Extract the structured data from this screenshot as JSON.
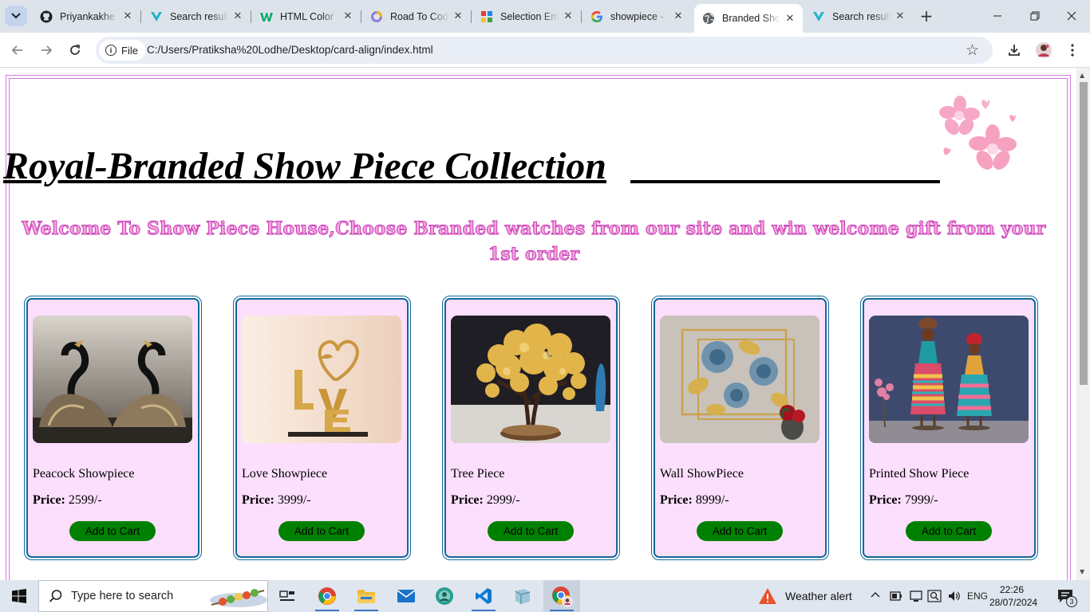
{
  "browser": {
    "tabs": [
      {
        "label": "Priyankakhe",
        "icon": "github-icon",
        "active": false
      },
      {
        "label": "Search result",
        "icon": "v-logo-icon",
        "active": false
      },
      {
        "label": "HTML Color",
        "icon": "w-logo-icon",
        "active": false
      },
      {
        "label": "Road To Cod",
        "icon": "ring-logo-icon",
        "active": false
      },
      {
        "label": "Selection Em",
        "icon": "grid-logo-icon",
        "active": false
      },
      {
        "label": "showpiece -",
        "icon": "google-icon",
        "active": false
      },
      {
        "label": "Branded Sho",
        "icon": "globe-icon",
        "active": true
      },
      {
        "label": "Search result",
        "icon": "v-logo-icon",
        "active": false
      }
    ],
    "address": {
      "scheme_label": "File",
      "url": "C:/Users/Pratiksha%20Lodhe/Desktop/card-align/index.html"
    }
  },
  "page": {
    "title": "Royal-Branded Show Piece Collection",
    "welcome": "Welcome To Show Piece House,Choose Branded watches from our site and win welcome gift from your 1st order",
    "price_label": "Price:",
    "cart_label": "Add to Cart",
    "accent_colors": {
      "border": "#d47adf",
      "card_bg": "#fcdffc",
      "card_border": "#13689a",
      "button": "#008000",
      "welcome_fill": "#f5a5de",
      "welcome_stroke": "#c83bb8"
    },
    "products": [
      {
        "name": "Peacock Showpiece",
        "price": "2599/-",
        "image": "swan-pair-image"
      },
      {
        "name": "Love Showpiece",
        "price": "3999/-",
        "image": "love-heart-image"
      },
      {
        "name": "Tree Piece",
        "price": "2999/-",
        "image": "gem-tree-image"
      },
      {
        "name": "Wall ShowPiece",
        "price": "8999/-",
        "image": "wall-flowers-image"
      },
      {
        "name": "Printed Show Piece",
        "price": "7999/-",
        "image": "printed-dolls-image"
      }
    ]
  },
  "taskbar": {
    "search_placeholder": "Type here to search",
    "weather": "Weather alert",
    "language": "ENG",
    "time": "22:26",
    "date": "28/07/2024",
    "notification_count": "3"
  }
}
